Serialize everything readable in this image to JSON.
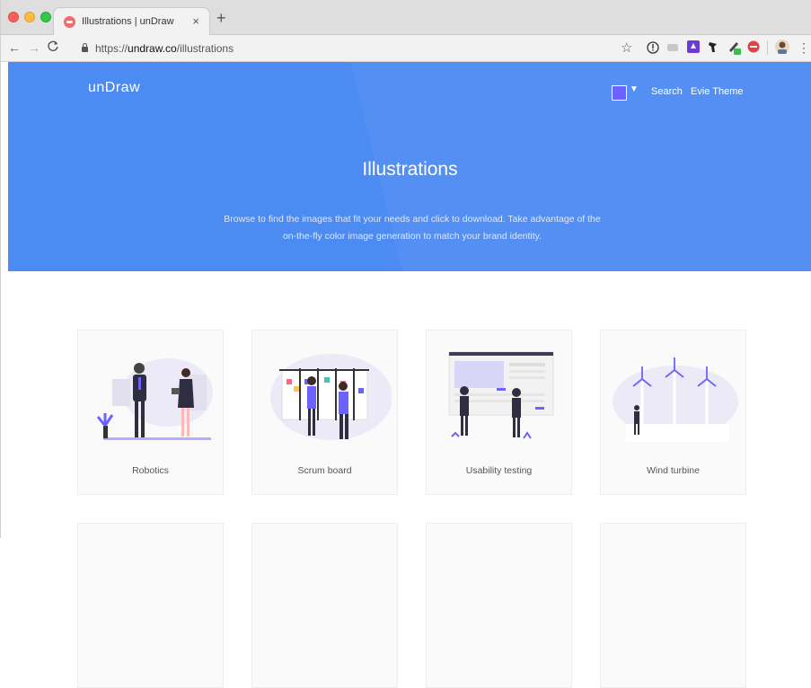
{
  "browser": {
    "tab": {
      "title": "Illustrations | unDraw",
      "close": "×"
    },
    "new_tab": "+",
    "nav": {
      "back": "←",
      "forward": "→",
      "reload": "C"
    },
    "url_prefix": "https://",
    "url_host": "undraw.co",
    "url_path": "/illustrations",
    "star": "☆",
    "menu": "⋮"
  },
  "site": {
    "brand": "unDraw",
    "swatch_color": "#6c63ff",
    "swatch_caret": "▼",
    "nav": {
      "search": "Search",
      "theme": "Evie Theme"
    }
  },
  "hero": {
    "title": "Illustrations",
    "description": "Browse to find the images that fit your needs and click to download. Take advantage of the on-the-fly color image generation to match your brand identity."
  },
  "cards": [
    {
      "label": "Robotics"
    },
    {
      "label": "Scrum board"
    },
    {
      "label": "Usability testing"
    },
    {
      "label": "Wind turbine"
    }
  ],
  "colors": {
    "hero": "#4c8bf1",
    "accent": "#6c63ff"
  }
}
